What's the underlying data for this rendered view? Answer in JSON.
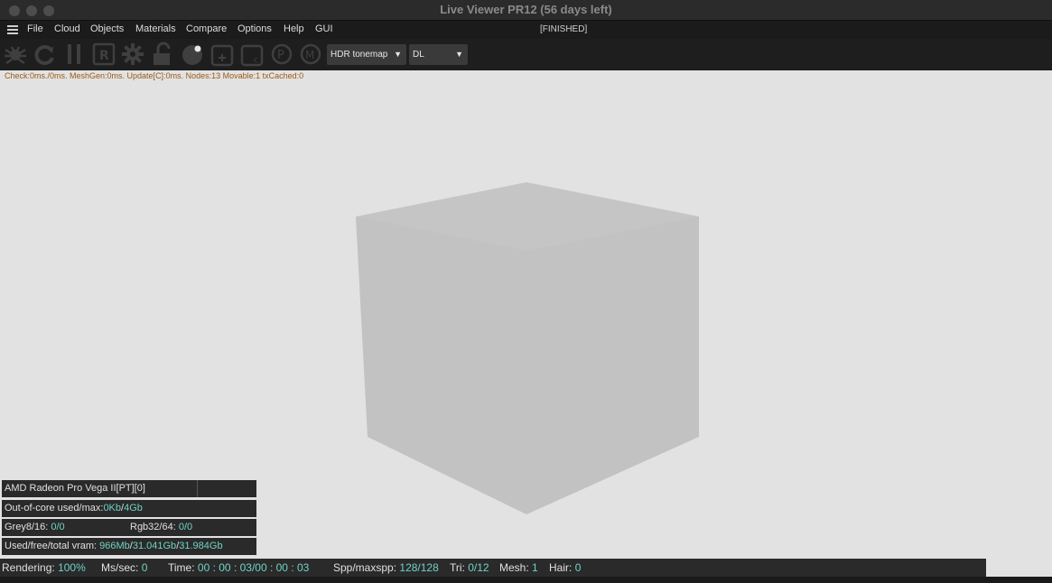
{
  "window": {
    "title": "Live Viewer PR12 (56 days left)"
  },
  "menu": {
    "items": [
      "File",
      "Cloud",
      "Objects",
      "Materials",
      "Compare",
      "Options",
      "Help",
      "GUI"
    ],
    "status": "[FINISHED]"
  },
  "toolbar": {
    "tools": [
      "bug-icon",
      "refresh-icon",
      "pause-icon",
      "r-icon",
      "gear-icon",
      "unlock-icon",
      "sphere-icon",
      "add-object-icon",
      "add-camera-icon",
      "copyright-icon",
      "m-icon"
    ],
    "tonemap_select": "HDR tonemap",
    "mode_select": "DL"
  },
  "debug": {
    "text": "Check:0ms./0ms. MeshGen:0ms. Update[C]:0ms. Nodes:13 Movable:1 txCached:0"
  },
  "info": {
    "gpu": "AMD Radeon Pro Vega II[PT][0]",
    "ooc_label": "Out-of-core used/max:",
    "ooc_used": "0Kb",
    "ooc_max": "4Gb",
    "grey_label": "Grey8/16:",
    "grey_value": "0/0",
    "rgb_label": "Rgb32/64:",
    "rgb_value": "0/0",
    "vram_label": "Used/free/total vram:",
    "vram_used": "966Mb",
    "vram_free": "31.041Gb",
    "vram_total": "31.984Gb"
  },
  "status": {
    "rendering_label": "Rendering:",
    "rendering_value": "100%",
    "ms_label": "Ms/sec:",
    "ms_value": "0",
    "time_label": "Time:",
    "time_value": "00 : 00 : 03/00 : 00 : 03",
    "spp_label": "Spp/maxspp:",
    "spp_value": "128/128",
    "tri_label": "Tri:",
    "tri_value": "0/12",
    "mesh_label": "Mesh:",
    "mesh_value": "1",
    "hair_label": "Hair:",
    "hair_value": "0"
  },
  "colors": {
    "accent": "#6fd3c4",
    "viewport": "#e2e2e2",
    "cube": "#c2c2c2",
    "debug_text": "#9a5a17"
  }
}
